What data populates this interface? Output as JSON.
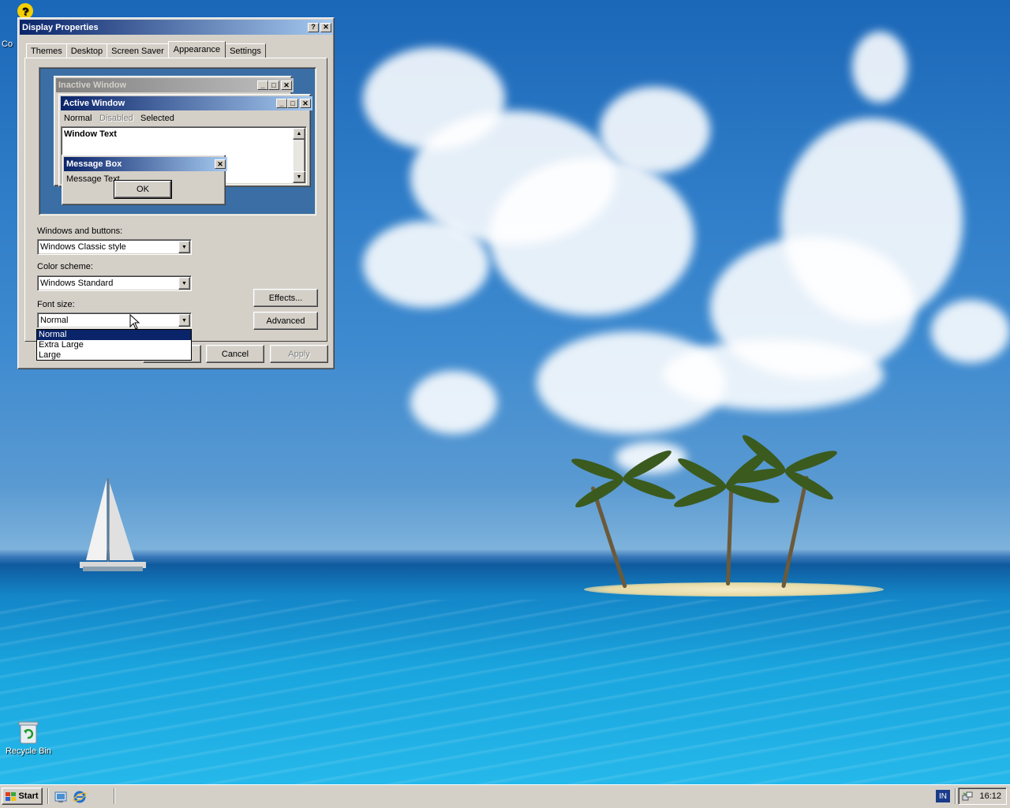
{
  "desktop": {
    "icons": {
      "help_icon_label": "Co",
      "recycle_bin_label": "Recycle Bin"
    }
  },
  "dialog": {
    "title": "Display Properties",
    "help_btn": "?",
    "close_btn": "✕",
    "tabs": [
      "Themes",
      "Desktop",
      "Screen Saver",
      "Appearance",
      "Settings"
    ],
    "active_tab": "Appearance",
    "preview": {
      "inactive_title": "Inactive Window",
      "active_title": "Active Window",
      "menu": {
        "normal": "Normal",
        "disabled": "Disabled",
        "selected": "Selected"
      },
      "window_text": "Window Text",
      "msgbox_title": "Message Box",
      "msgbox_text": "Message Text",
      "ok": "OK"
    },
    "windows_buttons_label": "Windows and buttons:",
    "windows_buttons_value": "Windows Classic style",
    "color_scheme_label": "Color scheme:",
    "color_scheme_value": "Windows Standard",
    "font_size_label": "Font size:",
    "font_size_value": "Normal",
    "font_size_options": [
      "Normal",
      "Extra Large",
      "Large"
    ],
    "effects_btn": "Effects...",
    "advanced_btn": "Advanced",
    "cancel_btn": "Cancel",
    "apply_btn": "Apply"
  },
  "taskbar": {
    "start_label": "Start",
    "language": "IN",
    "clock": "16:12"
  }
}
